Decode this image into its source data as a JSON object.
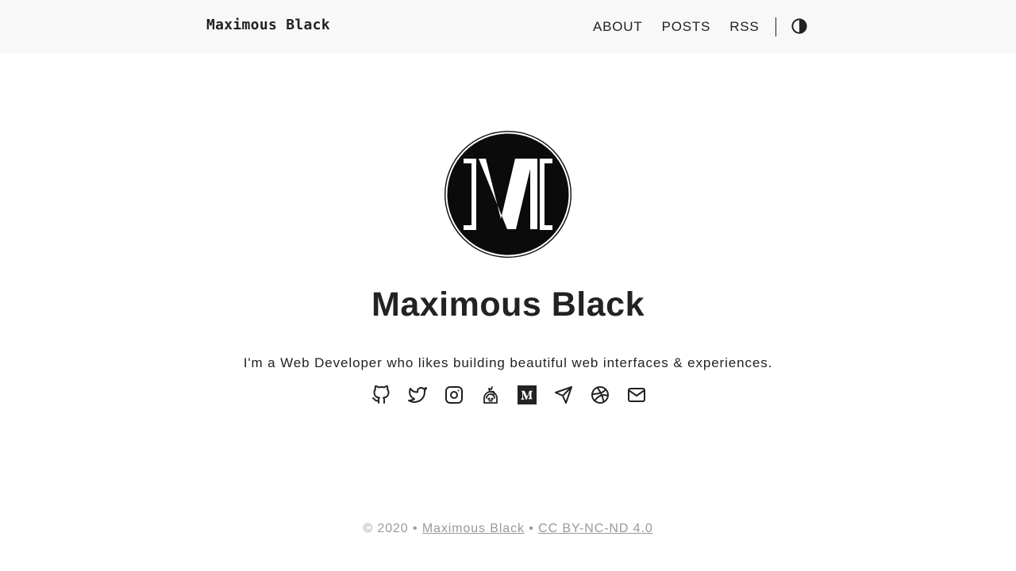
{
  "header": {
    "site_title": "Maximous Black",
    "nav": [
      {
        "label": "ABOUT"
      },
      {
        "label": "POSTS"
      },
      {
        "label": "RSS"
      }
    ],
    "theme_toggle_icon": "contrast-icon"
  },
  "hero": {
    "avatar_icon": "m-monogram-logo",
    "name": "Maximous Black",
    "tagline": "I'm a Web Developer who likes building beautiful web interfaces & experiences."
  },
  "social_icons": [
    "github-icon",
    "twitter-icon",
    "instagram-icon",
    "stackoverflow-icon",
    "medium-icon",
    "telegram-icon",
    "dribbble-icon",
    "email-icon"
  ],
  "footer": {
    "copyright": "© 2020 •",
    "author_link": "Maximous Black",
    "separator": "•",
    "license_link": "CC BY-NC-ND 4.0"
  },
  "colors": {
    "text": "#222222",
    "header_bg": "#f8f8f8",
    "footer_text": "#999999",
    "avatar_bg": "#0b0b0b"
  }
}
